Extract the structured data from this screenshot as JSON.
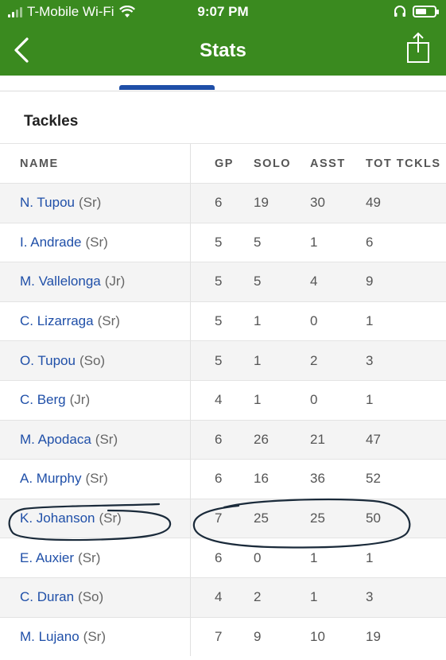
{
  "status_bar": {
    "carrier": "T-Mobile Wi-Fi",
    "time": "9:07 PM"
  },
  "nav": {
    "title": "Stats"
  },
  "section": {
    "title": "Tackles"
  },
  "table": {
    "headers": {
      "name": "NAME",
      "gp": "GP",
      "solo": "SOLO",
      "asst": "ASST",
      "tot": "TOT TCKLS"
    },
    "rows": [
      {
        "name": "N. Tupou",
        "cls": "(Sr)",
        "gp": "6",
        "solo": "19",
        "asst": "30",
        "tot": "49"
      },
      {
        "name": "I. Andrade",
        "cls": "(Sr)",
        "gp": "5",
        "solo": "5",
        "asst": "1",
        "tot": "6"
      },
      {
        "name": "M. Vallelonga",
        "cls": "(Jr)",
        "gp": "5",
        "solo": "5",
        "asst": "4",
        "tot": "9"
      },
      {
        "name": "C. Lizarraga",
        "cls": "(Sr)",
        "gp": "5",
        "solo": "1",
        "asst": "0",
        "tot": "1"
      },
      {
        "name": "O. Tupou",
        "cls": "(So)",
        "gp": "5",
        "solo": "1",
        "asst": "2",
        "tot": "3"
      },
      {
        "name": "C. Berg",
        "cls": "(Jr)",
        "gp": "4",
        "solo": "1",
        "asst": "0",
        "tot": "1"
      },
      {
        "name": "M. Apodaca",
        "cls": "(Sr)",
        "gp": "6",
        "solo": "26",
        "asst": "21",
        "tot": "47"
      },
      {
        "name": "A. Murphy",
        "cls": "(Sr)",
        "gp": "6",
        "solo": "16",
        "asst": "36",
        "tot": "52"
      },
      {
        "name": "K. Johanson",
        "cls": "(Sr)",
        "gp": "7",
        "solo": "25",
        "asst": "25",
        "tot": "50"
      },
      {
        "name": "E. Auxier",
        "cls": "(Sr)",
        "gp": "6",
        "solo": "0",
        "asst": "1",
        "tot": "1"
      },
      {
        "name": "C. Duran",
        "cls": "(So)",
        "gp": "4",
        "solo": "2",
        "asst": "1",
        "tot": "3"
      },
      {
        "name": "M. Lujano",
        "cls": "(Sr)",
        "gp": "7",
        "solo": "9",
        "asst": "10",
        "tot": "19"
      }
    ]
  },
  "colors": {
    "nav_green": "#3a8a1f",
    "link_blue": "#1f4fa8",
    "annotation_ink": "#1a2a3a"
  }
}
